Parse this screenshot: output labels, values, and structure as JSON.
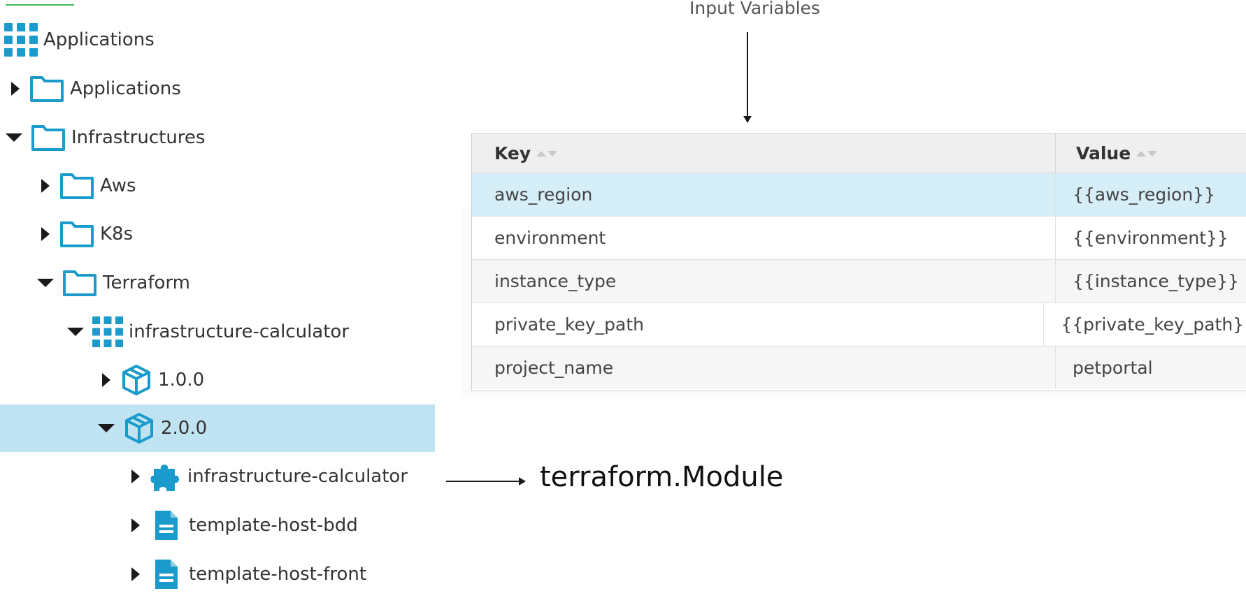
{
  "tree": {
    "root_label": "Applications",
    "items": [
      {
        "label": "Applications",
        "state": "collapsed",
        "icon": "folder-icon"
      },
      {
        "label": "Infrastructures",
        "state": "expanded",
        "icon": "folder-icon"
      },
      {
        "label": "Aws",
        "state": "collapsed",
        "icon": "folder-icon"
      },
      {
        "label": "K8s",
        "state": "collapsed",
        "icon": "folder-icon"
      },
      {
        "label": "Terraform",
        "state": "expanded",
        "icon": "folder-icon"
      },
      {
        "label": "infrastructure-calculator",
        "state": "expanded",
        "icon": "application-grid-icon"
      },
      {
        "label": "1.0.0",
        "state": "collapsed",
        "icon": "package-icon"
      },
      {
        "label": "2.0.0",
        "state": "expanded",
        "icon": "package-icon",
        "selected": true
      },
      {
        "label": "infrastructure-calculator",
        "state": "collapsed",
        "icon": "puzzle-icon"
      },
      {
        "label": "template-host-bdd",
        "state": "collapsed",
        "icon": "document-icon"
      },
      {
        "label": "template-host-front",
        "state": "collapsed",
        "icon": "document-icon"
      }
    ]
  },
  "annotations": {
    "input_variables": "Input Variables",
    "module_type": "terraform.Module"
  },
  "table": {
    "headers": {
      "key": "Key",
      "value": "Value"
    },
    "rows": [
      {
        "key": "aws_region",
        "value": "{{aws_region}}",
        "selected": true
      },
      {
        "key": "environment",
        "value": "{{environment}}"
      },
      {
        "key": "instance_type",
        "value": "{{instance_type}}"
      },
      {
        "key": "private_key_path",
        "value": "{{private_key_path}}"
      },
      {
        "key": "project_name",
        "value": "petportal"
      }
    ]
  },
  "colors": {
    "icon_blue": "#1a9bcb",
    "selected_row": "#bfe3f1",
    "table_selected_row": "#d6eef7"
  }
}
